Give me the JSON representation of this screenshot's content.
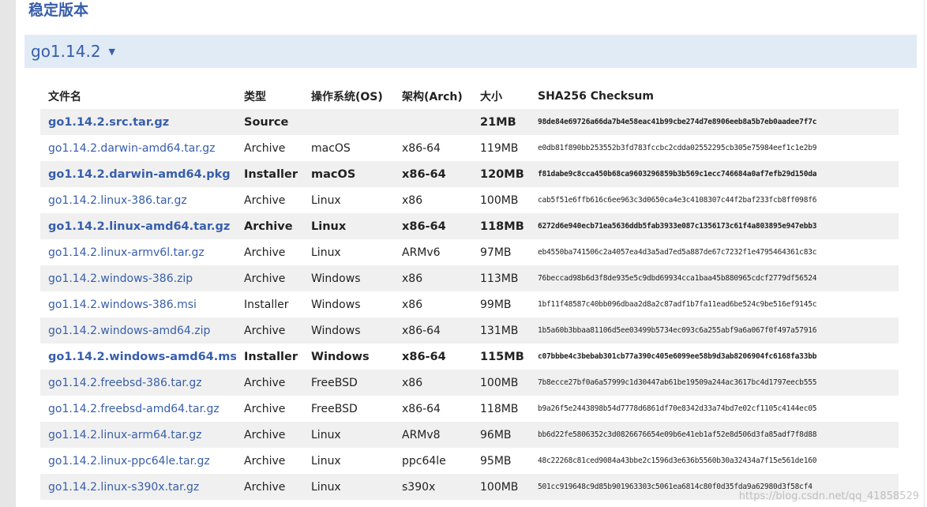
{
  "section_title": "稳定版本",
  "version": {
    "label": "go1.14.2",
    "toggle_icon": "triangle-down-icon"
  },
  "colors": {
    "link": "#375eab",
    "version_bar_bg": "#e0ebf5",
    "row_alt_bg": "#f0f0f0"
  },
  "table": {
    "headers": {
      "filename": "文件名",
      "kind": "类型",
      "os": "操作系统(OS)",
      "arch": "架构(Arch)",
      "size": "大小",
      "checksum": "SHA256 Checksum"
    },
    "rows": [
      {
        "filename": "go1.14.2.src.tar.gz",
        "kind": "Source",
        "os": "",
        "arch": "",
        "size": "21MB",
        "checksum": "98de84e69726a66da7b4e58eac41b99cbe274d7e8906eeb8a5b7eb0aadee7f7c"
      },
      {
        "filename": "go1.14.2.darwin-amd64.tar.gz",
        "kind": "Archive",
        "os": "macOS",
        "arch": "x86-64",
        "size": "119MB",
        "checksum": "e0db81f890bb253552b3fd783fccbc2cdda02552295cb305e75984eef1c1e2b9"
      },
      {
        "filename": "go1.14.2.darwin-amd64.pkg",
        "kind": "Installer",
        "os": "macOS",
        "arch": "x86-64",
        "size": "120MB",
        "checksum": "f81dabe9c8cca450b68ca9603296859b3b569c1ecc746684a0af7efb29d150da"
      },
      {
        "filename": "go1.14.2.linux-386.tar.gz",
        "kind": "Archive",
        "os": "Linux",
        "arch": "x86",
        "size": "100MB",
        "checksum": "cab5f51e6ffb616c6ee963c3d0650ca4e3c4108307c44f2baf233fcb8ff098f6"
      },
      {
        "filename": "go1.14.2.linux-amd64.tar.gz",
        "kind": "Archive",
        "os": "Linux",
        "arch": "x86-64",
        "size": "118MB",
        "checksum": "6272d6e940ecb71ea5636ddb5fab3933e087c1356173c61f4a803895e947ebb3"
      },
      {
        "filename": "go1.14.2.linux-armv6l.tar.gz",
        "kind": "Archive",
        "os": "Linux",
        "arch": "ARMv6",
        "size": "97MB",
        "checksum": "eb4550ba741506c2a4057ea4d3a5ad7ed5a887de67c7232f1e4795464361c83c"
      },
      {
        "filename": "go1.14.2.windows-386.zip",
        "kind": "Archive",
        "os": "Windows",
        "arch": "x86",
        "size": "113MB",
        "checksum": "76beccad98b6d3f8de935e5c9dbd69934cca1baa45b880965cdcf2779df56524"
      },
      {
        "filename": "go1.14.2.windows-386.msi",
        "kind": "Installer",
        "os": "Windows",
        "arch": "x86",
        "size": "99MB",
        "checksum": "1bf11f48587c40bb096dbaa2d8a2c87adf1b7fa11ead6be524c9be516ef9145c"
      },
      {
        "filename": "go1.14.2.windows-amd64.zip",
        "kind": "Archive",
        "os": "Windows",
        "arch": "x86-64",
        "size": "131MB",
        "checksum": "1b5a60b3bbaa81106d5ee03499b5734ec093c6a255abf9a6a067f0f497a57916"
      },
      {
        "filename": "go1.14.2.windows-amd64.msi",
        "kind": "Installer",
        "os": "Windows",
        "arch": "x86-64",
        "size": "115MB",
        "checksum": "c07bbbe4c3bebab301cb77a390c405e6099ee58b9d3ab8206904fc6168fa33bb"
      },
      {
        "filename": "go1.14.2.freebsd-386.tar.gz",
        "kind": "Archive",
        "os": "FreeBSD",
        "arch": "x86",
        "size": "100MB",
        "checksum": "7b8ecce27bf0a6a57999c1d30447ab61be19509a244ac3617bc4d1797eecb555"
      },
      {
        "filename": "go1.14.2.freebsd-amd64.tar.gz",
        "kind": "Archive",
        "os": "FreeBSD",
        "arch": "x86-64",
        "size": "118MB",
        "checksum": "b9a26f5e2443898b54d7778d6861df70e8342d33a74bd7e02cf1105c4144ec05"
      },
      {
        "filename": "go1.14.2.linux-arm64.tar.gz",
        "kind": "Archive",
        "os": "Linux",
        "arch": "ARMv8",
        "size": "96MB",
        "checksum": "bb6d22fe5806352c3d0826676654e09b6e41eb1af52e8d506d3fa85adf7f8d88"
      },
      {
        "filename": "go1.14.2.linux-ppc64le.tar.gz",
        "kind": "Archive",
        "os": "Linux",
        "arch": "ppc64le",
        "size": "95MB",
        "checksum": "48c22268c81ced9084a43bbe2c1596d3e636b5560b30a32434a7f15e561de160"
      },
      {
        "filename": "go1.14.2.linux-s390x.tar.gz",
        "kind": "Archive",
        "os": "Linux",
        "arch": "s390x",
        "size": "100MB",
        "checksum": "501cc919648c9d85b901963303c5061ea6814c80f0d35fda9a62980d3f58cf4"
      }
    ],
    "highlighted_rows": [
      0,
      2,
      4,
      9
    ]
  },
  "watermark": "https://blog.csdn.net/qq_41858529"
}
